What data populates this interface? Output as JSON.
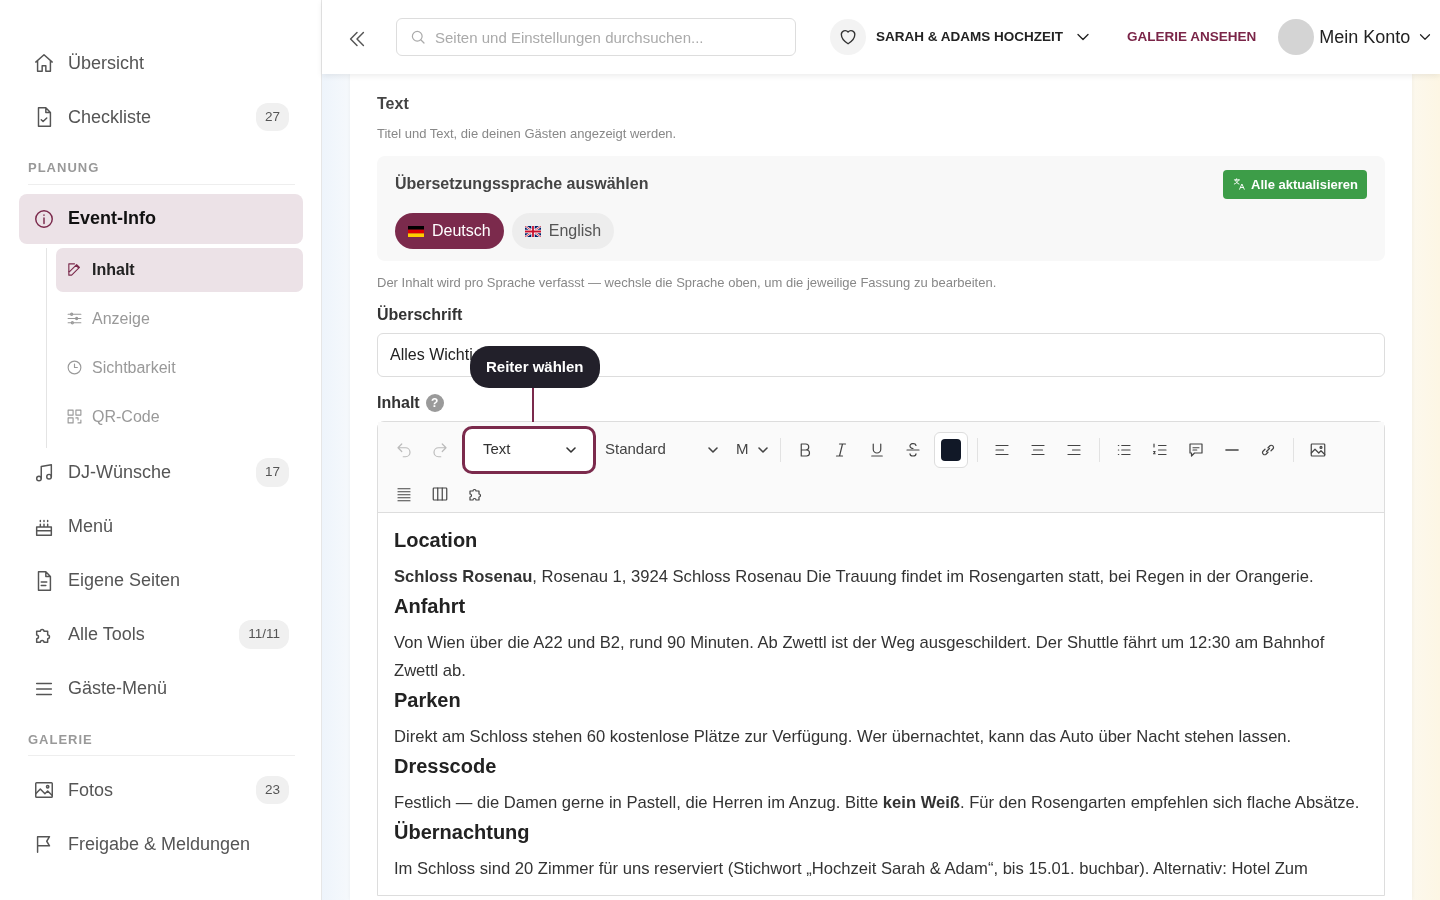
{
  "sidebar": {
    "items": [
      {
        "kind": "link",
        "label": "Übersicht",
        "selected": false
      },
      {
        "kind": "link",
        "label": "Checkliste",
        "badge": "27",
        "selected": false
      },
      {
        "kind": "heading",
        "label": "PLANUNG"
      },
      {
        "kind": "link",
        "label": "Event-Info",
        "selected": true,
        "children": [
          {
            "kind": "link",
            "label": "Inhalt",
            "selected": true
          },
          {
            "kind": "link",
            "label": "Anzeige",
            "selected": false
          },
          {
            "kind": "link",
            "label": "Sichtbarkeit",
            "selected": false
          },
          {
            "kind": "link",
            "label": "QR-Code",
            "selected": false
          }
        ]
      },
      {
        "kind": "link",
        "label": "DJ-Wünsche",
        "badge": "17",
        "selected": false
      },
      {
        "kind": "link",
        "label": "Menü",
        "selected": false
      },
      {
        "kind": "link",
        "label": "Eigene Seiten",
        "selected": false
      },
      {
        "kind": "link",
        "label": "Alle Tools",
        "badge": "11/11",
        "selected": false
      },
      {
        "kind": "link",
        "label": "Gäste-Menü",
        "selected": false
      },
      {
        "kind": "heading",
        "label": "GALERIE"
      },
      {
        "kind": "link",
        "label": "Fotos",
        "badge": "23",
        "selected": false
      },
      {
        "kind": "link",
        "label": "Freigabe & Meldungen",
        "selected": false
      }
    ]
  },
  "topbar": {
    "search": {
      "placeholder": "Seiten und Einstellungen durchsuchen..."
    },
    "event": "SARAH & ADAMS HOCHZEIT",
    "gallery_link": "GALERIE ANSEHEN",
    "account": "Mein Konto"
  },
  "section": {
    "title": "Text",
    "subtitle": "Titel und Text, die deinen Gästen angezeigt werden.",
    "translation": {
      "label": "Übersetzungssprache auswählen",
      "button": "Alle aktualisieren",
      "languages": [
        {
          "label": "Deutsch",
          "selected": true
        },
        {
          "label": "English",
          "selected": false
        }
      ]
    },
    "note": "Der Inhalt wird pro Sprache verfasst — wechsle die Sprache oben, um die jeweilige Fassung zu bearbeiten.",
    "heading_field": {
      "label": "Überschrift",
      "value": "Alles Wichti"
    },
    "content_field": {
      "label": "Inhalt",
      "help": "?",
      "tooltip": "Reiter wählen",
      "toolbar": {
        "block_type": "Text",
        "font": "Standard",
        "size": "M"
      },
      "blocks": [
        {
          "kind": "heading",
          "text": "Location"
        },
        {
          "kind": "paragraph",
          "text": "**Schloss Rosenau**, Rosenau 1, 3924 Schloss Rosenau Die Trauung findet im Rosengarten statt, bei Regen in der Orangerie."
        },
        {
          "kind": "heading",
          "text": "Anfahrt"
        },
        {
          "kind": "paragraph",
          "text": "Von Wien über die A22 und B2, rund 90 Minuten. Ab Zwettl ist der Weg ausgeschildert. Der Shuttle fährt um 12:30 am Bahnhof Zwettl ab."
        },
        {
          "kind": "heading",
          "text": "Parken"
        },
        {
          "kind": "paragraph",
          "text": "Direkt am Schloss stehen 60 kostenlose Plätze zur Verfügung. Wer übernachtet, kann das Auto über Nacht stehen lassen."
        },
        {
          "kind": "heading",
          "text": "Dresscode"
        },
        {
          "kind": "paragraph",
          "text": "Festlich — die Damen gerne in Pastell, die Herren im Anzug. Bitte **kein Weiß**. Für den Rosengarten empfehlen sich flache Absätze."
        },
        {
          "kind": "heading",
          "text": "Übernachtung"
        },
        {
          "kind": "paragraph",
          "text": "Im Schloss sind 20 Zimmer für uns reserviert (Stichwort „Hochzeit Sarah & Adam“, bis 15.01. buchbar). Alternativ: Hotel Zum"
        }
      ]
    }
  }
}
